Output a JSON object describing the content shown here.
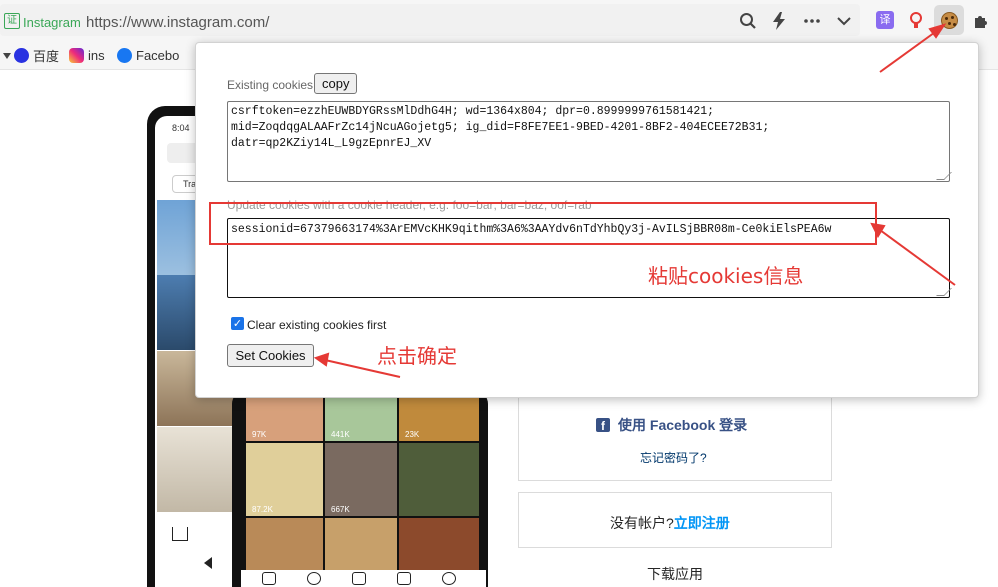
{
  "browser": {
    "site_label": "Instagram",
    "url": "https://www.instagram.com/",
    "cert_glyph": "证",
    "translate_glyph": "译",
    "icons": [
      "search-icon",
      "lightning-icon",
      "more-icon",
      "chevron-down-icon",
      "translate-icon",
      "lamp-icon",
      "cookie-icon",
      "puzzle-icon"
    ]
  },
  "bookmarks": [
    {
      "label": "百度",
      "color": "#2932e1"
    },
    {
      "label": "ins",
      "color": "#d6249f"
    },
    {
      "label": "Facebo",
      "color": "#1877f2"
    }
  ],
  "popup": {
    "existing_label": "Existing cookies",
    "copy_label": "copy",
    "existing_cookies": "csrftoken=ezzhEUWBDYGRssMlDdhG4H; wd=1364x804; dpr=0.8999999761581421;\nmid=ZoqdqgALAAFrZc14jNcuAGojetg5; ig_did=F8FE7EE1-9BED-4201-8BF2-404ECEE72B31;\ndatr=qp2KZiy14L_L9gzEpnrEJ_XV",
    "update_label": "Update cookies with a cookie header, e.g. foo=bar; bar=baz; oof=rab",
    "update_value": "sessionid=67379663174%3ArEMVcKHK9qithm%3A6%3AAYdv6nTdYhbQy3j-AvILSjBBR08m-Ce0kiElsPEA6w",
    "clear_label": "Clear existing cookies first",
    "clear_checked": true,
    "set_label": "Set Cookies"
  },
  "annotations": {
    "paste_note": "粘贴cookies信息",
    "confirm_note": "点击确定",
    "color": "#e53935"
  },
  "page": {
    "phone_time": "8:04",
    "tab_label": "Tra",
    "video_counts": [
      "97K",
      "441K",
      "23K",
      "87.2K",
      "667K"
    ],
    "facebook_login": "使用 Facebook 登录",
    "forgot_password": "忘记密码了?",
    "no_account": "没有帐户?",
    "signup": "立即注册",
    "download_app": "下载应用"
  }
}
